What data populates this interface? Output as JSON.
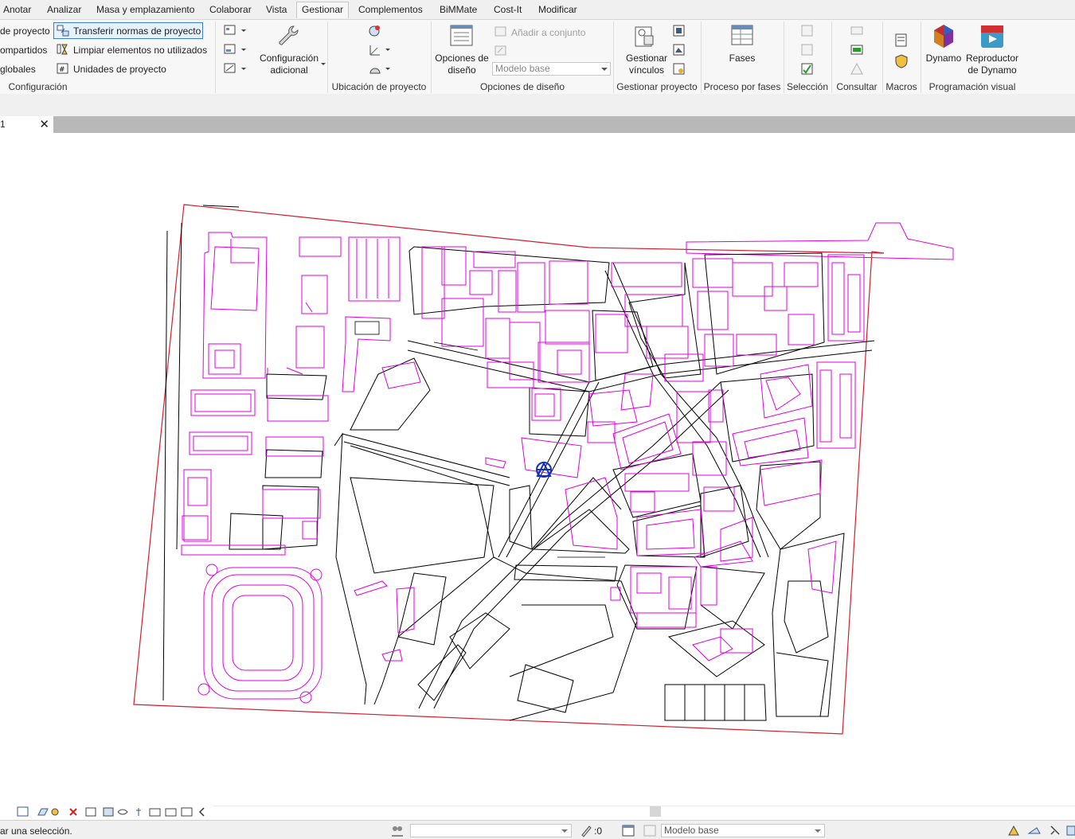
{
  "tabs": [
    "Anotar",
    "Analizar",
    "Masa y emplazamiento",
    "Colaborar",
    "Vista",
    "Gestionar",
    "Complementos",
    "BiMMate",
    "Cost-It",
    "Modificar"
  ],
  "active_tab": "Gestionar",
  "ribbon": {
    "config": {
      "item1": "de proyecto",
      "item2": "ompartidos",
      "item3": "globales",
      "transfer": "Transferir normas de proyecto",
      "purge": "Limpiar elementos no utilizados",
      "units": "Unidades de proyecto",
      "label": "Configuración"
    },
    "additional": {
      "line1": "Configuración",
      "line2": "adicional"
    },
    "location": {
      "label": "Ubicación de proyecto"
    },
    "design": {
      "opts_line1": "Opciones de",
      "opts_line2": "diseño",
      "add_to_set": "Añadir a conjunto",
      "combo_value": "Modelo base",
      "label": "Opciones de diseño"
    },
    "project": {
      "links_line1": "Gestionar",
      "links_line2": "vínculos",
      "label": "Gestionar proyecto"
    },
    "phasing": {
      "btn": "Fases",
      "label": "Proceso por fases"
    },
    "selection": {
      "label": "Selección"
    },
    "inquiry": {
      "label": "Consultar"
    },
    "macros": {
      "label": "Macros"
    },
    "visual": {
      "dynamo": "Dynamo",
      "player_line1": "Reproductor",
      "player_line2": "de Dynamo",
      "label": "Programación visual"
    }
  },
  "view_tab": {
    "label": "1",
    "close": "✕"
  },
  "status": {
    "message": "ar una selección.",
    "filter_count": ":0",
    "design_option": "Modelo base"
  },
  "colors": {
    "boundary": "#d0202e",
    "buildings": "#e000e0",
    "streets": "#000000",
    "marker": "#1030c0"
  }
}
